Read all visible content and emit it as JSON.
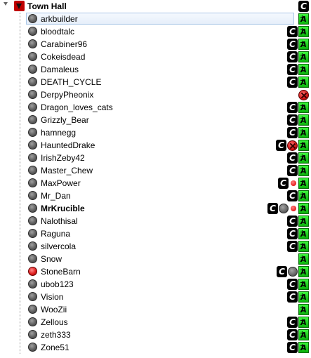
{
  "channel": {
    "name": "Town Hall",
    "icons": [
      "c"
    ]
  },
  "users": [
    {
      "name": "arkbuilder",
      "status": "idle",
      "icons": [
        "a"
      ],
      "selected": true
    },
    {
      "name": "bloodtalc",
      "status": "idle",
      "icons": [
        "c",
        "a"
      ]
    },
    {
      "name": "Carabiner96",
      "status": "idle",
      "icons": [
        "c",
        "a"
      ]
    },
    {
      "name": "Cokeisdead",
      "status": "idle",
      "icons": [
        "c",
        "a"
      ]
    },
    {
      "name": "Damaleus",
      "status": "idle",
      "icons": [
        "c",
        "a"
      ]
    },
    {
      "name": "DEATH_CYCLE",
      "status": "idle",
      "icons": [
        "c",
        "a"
      ]
    },
    {
      "name": "DerpyPheonix",
      "status": "idle",
      "icons": [
        "x"
      ]
    },
    {
      "name": "Dragon_loves_cats",
      "status": "idle",
      "icons": [
        "c",
        "a"
      ]
    },
    {
      "name": "Grizzly_Bear",
      "status": "idle",
      "icons": [
        "c",
        "a"
      ]
    },
    {
      "name": "hamnegg",
      "status": "idle",
      "icons": [
        "c",
        "a"
      ]
    },
    {
      "name": "HauntedDrake",
      "status": "idle",
      "icons": [
        "c",
        "x",
        "a"
      ]
    },
    {
      "name": "IrishZeby42",
      "status": "idle",
      "icons": [
        "c",
        "a"
      ]
    },
    {
      "name": "Master_Chew",
      "status": "idle",
      "icons": [
        "c",
        "a"
      ]
    },
    {
      "name": "MaxPower",
      "status": "idle",
      "icons": [
        "c",
        "dot",
        "a"
      ]
    },
    {
      "name": "Mr_Dan",
      "status": "idle",
      "icons": [
        "c",
        "a"
      ]
    },
    {
      "name": "MrKrucible",
      "status": "idle",
      "icons": [
        "c",
        "grey",
        "dot",
        "a"
      ],
      "bold": true
    },
    {
      "name": "Nalothisal",
      "status": "idle",
      "icons": [
        "c",
        "a"
      ]
    },
    {
      "name": "Raguna",
      "status": "idle",
      "icons": [
        "c",
        "a"
      ]
    },
    {
      "name": "silvercola",
      "status": "idle",
      "icons": [
        "c",
        "a"
      ]
    },
    {
      "name": "Snow",
      "status": "idle",
      "icons": [
        "a"
      ]
    },
    {
      "name": "StoneBarn",
      "status": "talking",
      "icons": [
        "c",
        "grey",
        "a"
      ]
    },
    {
      "name": "ubob123",
      "status": "idle",
      "icons": [
        "c",
        "a"
      ]
    },
    {
      "name": "Vision",
      "status": "idle",
      "icons": [
        "c",
        "a"
      ]
    },
    {
      "name": "WooZii",
      "status": "idle",
      "icons": [
        "a"
      ]
    },
    {
      "name": "Zellous",
      "status": "idle",
      "icons": [
        "c",
        "a"
      ]
    },
    {
      "name": "zeth333",
      "status": "idle",
      "icons": [
        "c",
        "a"
      ]
    },
    {
      "name": "Zone51",
      "status": "idle",
      "icons": [
        "c",
        "a"
      ]
    }
  ],
  "icon_glyphs": {
    "c": "C",
    "a": "A"
  },
  "colors": {
    "talking": "#e02020",
    "selection": "#a9c6e6"
  }
}
